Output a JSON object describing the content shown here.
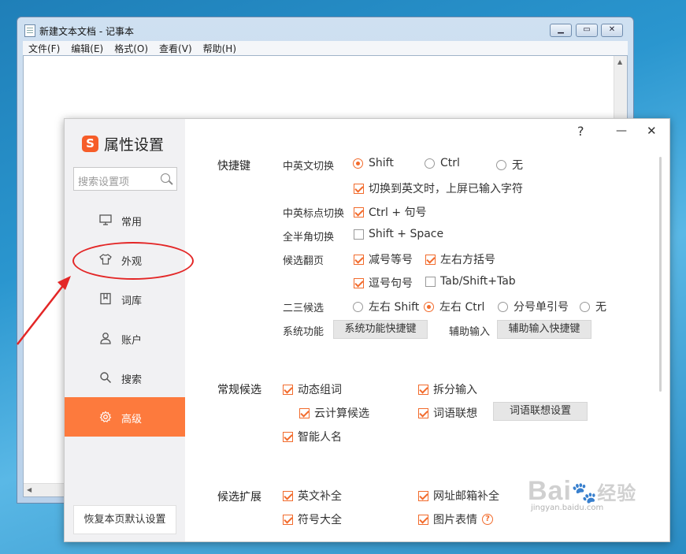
{
  "notepad": {
    "title": "新建文本文档 - 记事本",
    "menus": [
      "文件(F)",
      "编辑(E)",
      "格式(O)",
      "查看(V)",
      "帮助(H)"
    ]
  },
  "dialog": {
    "title": "属性设置",
    "controls": {
      "help": "?",
      "minimize": "—",
      "close": "✕"
    },
    "search_placeholder": "搜索设置项",
    "nav": [
      {
        "label": "常用",
        "icon": "monitor-icon",
        "active": false
      },
      {
        "label": "外观",
        "icon": "tshirt-icon",
        "active": false
      },
      {
        "label": "词库",
        "icon": "book-icon",
        "active": false
      },
      {
        "label": "账户",
        "icon": "user-icon",
        "active": false
      },
      {
        "label": "搜索",
        "icon": "search-icon",
        "active": false
      },
      {
        "label": "高级",
        "icon": "gear-icon",
        "active": true
      }
    ],
    "reset_label": "恢复本页默认设置",
    "accent_color": "#fd7a3d"
  },
  "shortcuts": {
    "section_title": "快捷键",
    "cn_en_switch": {
      "label": "中英文切换",
      "options": [
        {
          "label": "Shift",
          "selected": true
        },
        {
          "label": "Ctrl",
          "selected": false
        },
        {
          "label": "无",
          "selected": false
        }
      ],
      "commit_on_switch": {
        "label": "切换到英文时，上屏已输入字符",
        "checked": true
      }
    },
    "punct_switch": {
      "label": "中英标点切换",
      "option": {
        "label": "Ctrl + 句号",
        "checked": true
      }
    },
    "width_switch": {
      "label": "全半角切换",
      "option": {
        "label": "Shift + Space",
        "checked": false
      }
    },
    "page_turn": {
      "label": "候选翻页",
      "options": [
        {
          "label": "减号等号",
          "checked": true
        },
        {
          "label": "左右方括号",
          "checked": true
        },
        {
          "label": "逗号句号",
          "checked": true
        },
        {
          "label": "Tab/Shift+Tab",
          "checked": false
        }
      ]
    },
    "second_third": {
      "label": "二三候选",
      "options": [
        {
          "label": "左右 Shift",
          "selected": false
        },
        {
          "label": "左右 Ctrl",
          "selected": true
        },
        {
          "label": "分号单引号",
          "selected": false
        },
        {
          "label": "无",
          "selected": false
        }
      ]
    },
    "system": {
      "label": "系统功能",
      "button": "系统功能快捷键"
    },
    "assist": {
      "label": "辅助输入",
      "button": "辅助输入快捷键"
    }
  },
  "candidates": {
    "section_title": "常规候选",
    "items": [
      {
        "label": "动态组词",
        "checked": true
      },
      {
        "label": "拆分输入",
        "checked": true
      },
      {
        "label": "云计算候选",
        "checked": true
      },
      {
        "label": "词语联想",
        "checked": true
      },
      {
        "label": "智能人名",
        "checked": true
      }
    ],
    "assoc_button": "词语联想设置"
  },
  "extension": {
    "section_title": "候选扩展",
    "items": [
      {
        "label": "英文补全",
        "checked": true
      },
      {
        "label": "网址邮箱补全",
        "checked": true
      },
      {
        "label": "符号大全",
        "checked": true
      },
      {
        "label": "图片表情",
        "checked": true
      }
    ],
    "help_glyph": "?"
  },
  "watermark": {
    "main": "Bai",
    "accent": "经验",
    "sub": "jingyan.baidu.com"
  }
}
